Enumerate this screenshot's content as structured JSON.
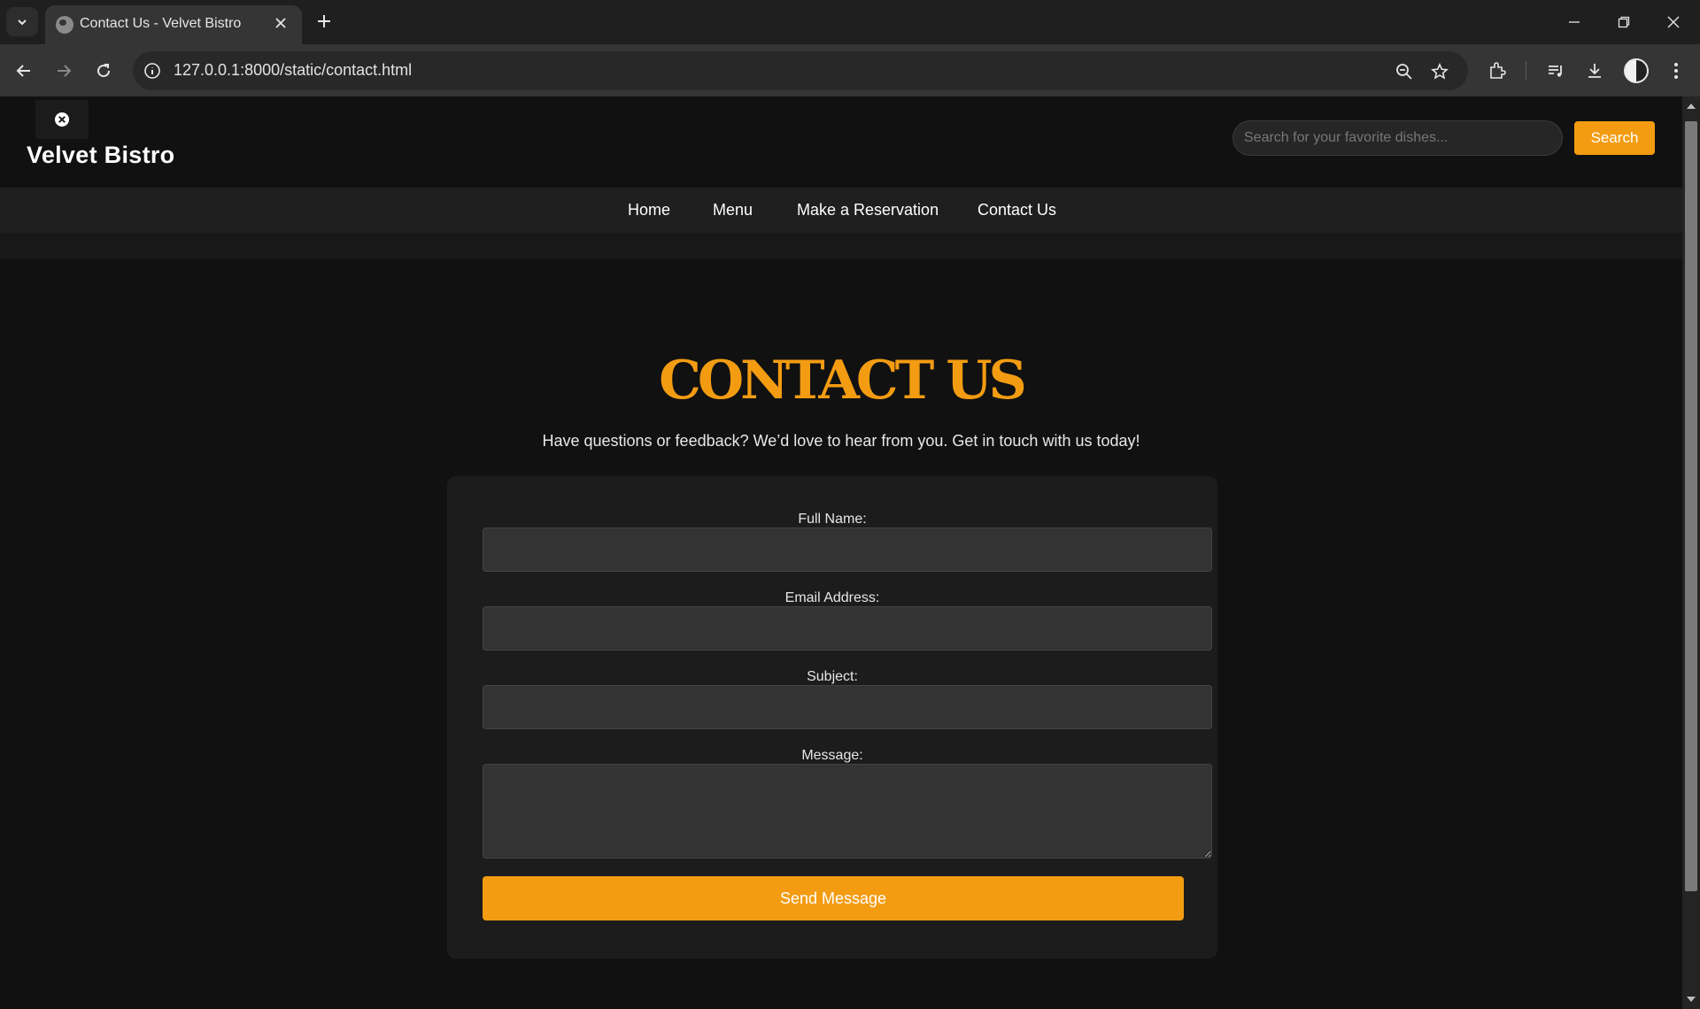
{
  "browser": {
    "tab_title": "Contact Us - Velvet Bistro",
    "url": "127.0.0.1:8000/static/contact.html"
  },
  "site": {
    "brand": "Velvet Bistro",
    "search": {
      "placeholder": "Search for your favorite dishes...",
      "button_label": "Search"
    },
    "nav": [
      {
        "label": "Home"
      },
      {
        "label": "Menu"
      },
      {
        "label": "Make a Reservation"
      },
      {
        "label": "Contact Us"
      }
    ]
  },
  "contact": {
    "title": "CONTACT US",
    "intro": "Have questions or feedback? We’d love to hear from you. Get in touch with us today!",
    "fields": {
      "full_name": {
        "label": "Full Name:",
        "value": ""
      },
      "email": {
        "label": "Email Address:",
        "value": ""
      },
      "subject": {
        "label": "Subject:",
        "value": ""
      },
      "message": {
        "label": "Message:",
        "value": ""
      }
    },
    "submit_label": "Send Message"
  },
  "colors": {
    "accent": "#f39c12",
    "page_background": "#111111",
    "card_background": "#1c1c1c",
    "input_background": "#333333"
  }
}
